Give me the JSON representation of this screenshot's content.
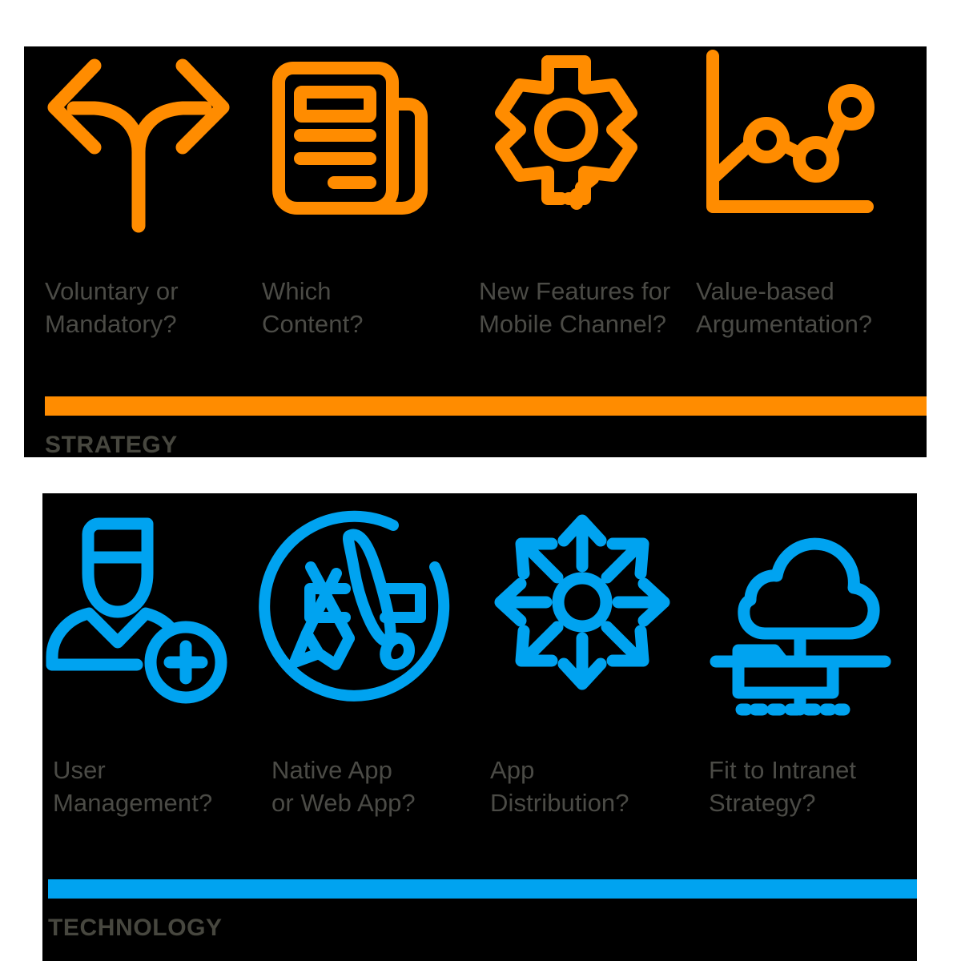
{
  "colors": {
    "strategy_accent": "#FF8C00",
    "technology_accent": "#00A3F0",
    "panel_background": "#000000",
    "label_text": "#4B4B46",
    "section_text": "#47473F",
    "page_background": "#FFFFFF"
  },
  "sections": [
    {
      "id": "strategy",
      "name": "STRATEGY",
      "accent": "#FF8C00",
      "cards": [
        {
          "icon": "fork-arrows-icon",
          "label": "Voluntary or\nMandatory?"
        },
        {
          "icon": "document-lines-icon",
          "label": "Which\nContent?"
        },
        {
          "icon": "gear-icon",
          "label": "New Features for\nMobile Channel?"
        },
        {
          "icon": "line-chart-icon",
          "label": "Value-based\nArgumentation?"
        }
      ]
    },
    {
      "id": "technology",
      "name": "TECHNOLOGY",
      "accent": "#00A3F0",
      "cards": [
        {
          "icon": "user-add-icon",
          "label": "User\nManagement?"
        },
        {
          "icon": "app-store-icon",
          "label": "Native App\nor Web App?"
        },
        {
          "icon": "distribution-arrows-icon",
          "label": "App\nDistribution?"
        },
        {
          "icon": "cloud-network-icon",
          "label": "Fit to Intranet\nStrategy?"
        }
      ]
    }
  ]
}
